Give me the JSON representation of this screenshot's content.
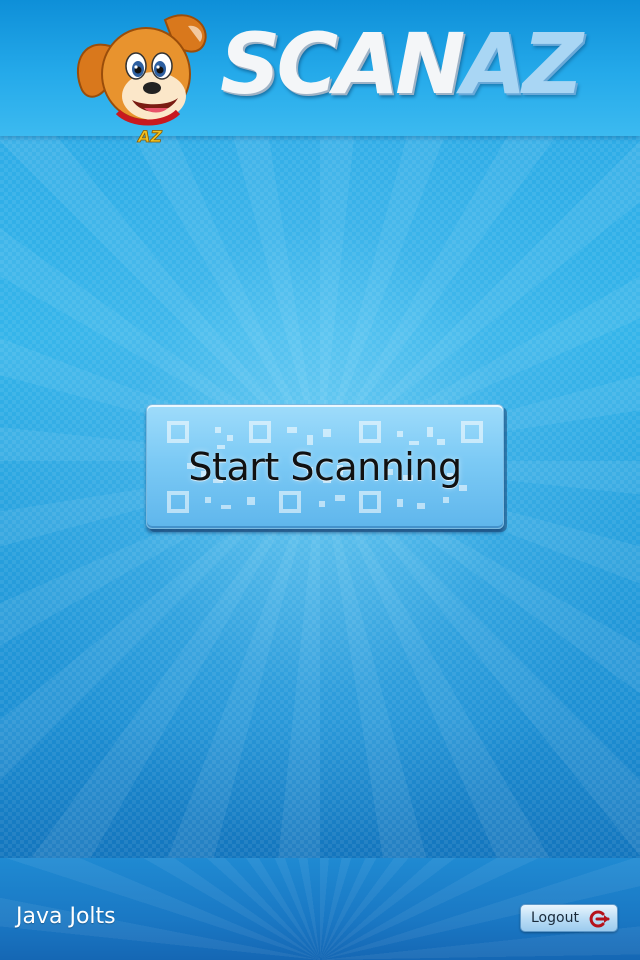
{
  "header": {
    "logo_text_1": "SCAN",
    "logo_text_2": "AZ",
    "mascot_badge": "AZ"
  },
  "main": {
    "start_label": "Start Scanning"
  },
  "footer": {
    "username": "Java Jolts",
    "logout_label": "Logout"
  },
  "icons": {
    "logout": "logout-arrow-icon",
    "mascot": "dog-mascot-icon"
  },
  "colors": {
    "accent": "#1c8fd6",
    "button": "#7ccaf5",
    "logout_icon": "#b5121b"
  }
}
